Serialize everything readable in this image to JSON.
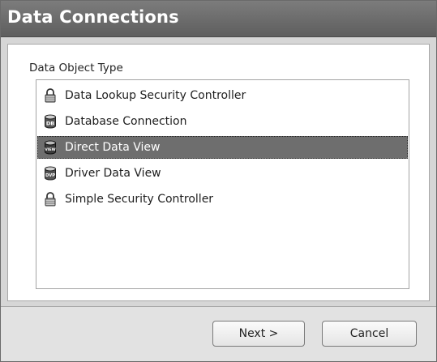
{
  "window": {
    "title": "Data Connections"
  },
  "panel": {
    "label": "Data Object Type"
  },
  "list": {
    "items": [
      {
        "label": "Data Lookup Security Controller",
        "icon": "padlock-icon",
        "selected": false
      },
      {
        "label": "Database Connection",
        "icon": "database-icon",
        "icon_text": "DB",
        "selected": false
      },
      {
        "label": "Direct Data View",
        "icon": "database-view-icon",
        "icon_text": "VIEW",
        "selected": true
      },
      {
        "label": "Driver Data View",
        "icon": "database-dvp-icon",
        "icon_text": "DVP",
        "selected": false
      },
      {
        "label": "Simple Security Controller",
        "icon": "padlock-icon",
        "selected": false
      }
    ]
  },
  "buttons": {
    "next_label": "Next >",
    "cancel_label": "Cancel"
  },
  "colors": {
    "titlebar": "#6a6a6a",
    "selection": "#6e6e6e"
  }
}
